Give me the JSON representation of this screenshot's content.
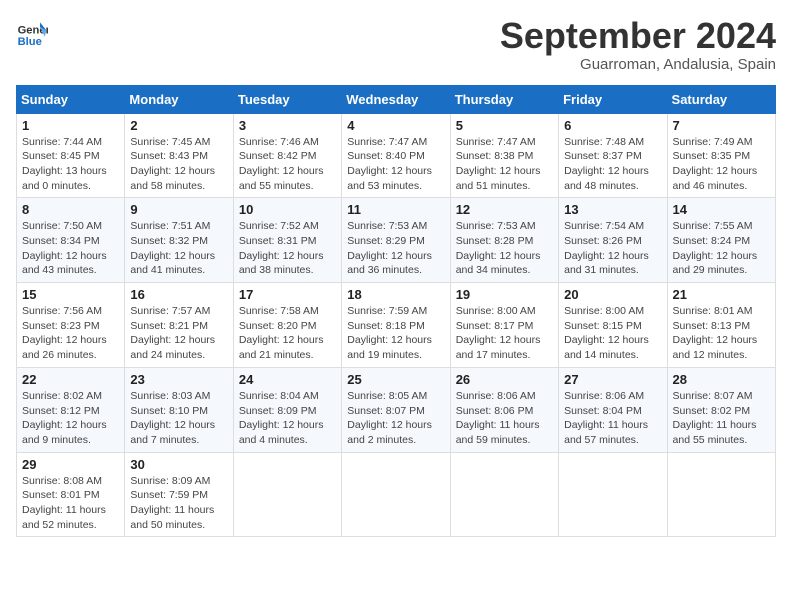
{
  "header": {
    "logo_line1": "General",
    "logo_line2": "Blue",
    "month_title": "September 2024",
    "location": "Guarroman, Andalusia, Spain"
  },
  "columns": [
    "Sunday",
    "Monday",
    "Tuesday",
    "Wednesday",
    "Thursday",
    "Friday",
    "Saturday"
  ],
  "weeks": [
    [
      {
        "day": "1",
        "info": "Sunrise: 7:44 AM\nSunset: 8:45 PM\nDaylight: 13 hours\nand 0 minutes."
      },
      {
        "day": "2",
        "info": "Sunrise: 7:45 AM\nSunset: 8:43 PM\nDaylight: 12 hours\nand 58 minutes."
      },
      {
        "day": "3",
        "info": "Sunrise: 7:46 AM\nSunset: 8:42 PM\nDaylight: 12 hours\nand 55 minutes."
      },
      {
        "day": "4",
        "info": "Sunrise: 7:47 AM\nSunset: 8:40 PM\nDaylight: 12 hours\nand 53 minutes."
      },
      {
        "day": "5",
        "info": "Sunrise: 7:47 AM\nSunset: 8:38 PM\nDaylight: 12 hours\nand 51 minutes."
      },
      {
        "day": "6",
        "info": "Sunrise: 7:48 AM\nSunset: 8:37 PM\nDaylight: 12 hours\nand 48 minutes."
      },
      {
        "day": "7",
        "info": "Sunrise: 7:49 AM\nSunset: 8:35 PM\nDaylight: 12 hours\nand 46 minutes."
      }
    ],
    [
      {
        "day": "8",
        "info": "Sunrise: 7:50 AM\nSunset: 8:34 PM\nDaylight: 12 hours\nand 43 minutes."
      },
      {
        "day": "9",
        "info": "Sunrise: 7:51 AM\nSunset: 8:32 PM\nDaylight: 12 hours\nand 41 minutes."
      },
      {
        "day": "10",
        "info": "Sunrise: 7:52 AM\nSunset: 8:31 PM\nDaylight: 12 hours\nand 38 minutes."
      },
      {
        "day": "11",
        "info": "Sunrise: 7:53 AM\nSunset: 8:29 PM\nDaylight: 12 hours\nand 36 minutes."
      },
      {
        "day": "12",
        "info": "Sunrise: 7:53 AM\nSunset: 8:28 PM\nDaylight: 12 hours\nand 34 minutes."
      },
      {
        "day": "13",
        "info": "Sunrise: 7:54 AM\nSunset: 8:26 PM\nDaylight: 12 hours\nand 31 minutes."
      },
      {
        "day": "14",
        "info": "Sunrise: 7:55 AM\nSunset: 8:24 PM\nDaylight: 12 hours\nand 29 minutes."
      }
    ],
    [
      {
        "day": "15",
        "info": "Sunrise: 7:56 AM\nSunset: 8:23 PM\nDaylight: 12 hours\nand 26 minutes."
      },
      {
        "day": "16",
        "info": "Sunrise: 7:57 AM\nSunset: 8:21 PM\nDaylight: 12 hours\nand 24 minutes."
      },
      {
        "day": "17",
        "info": "Sunrise: 7:58 AM\nSunset: 8:20 PM\nDaylight: 12 hours\nand 21 minutes."
      },
      {
        "day": "18",
        "info": "Sunrise: 7:59 AM\nSunset: 8:18 PM\nDaylight: 12 hours\nand 19 minutes."
      },
      {
        "day": "19",
        "info": "Sunrise: 8:00 AM\nSunset: 8:17 PM\nDaylight: 12 hours\nand 17 minutes."
      },
      {
        "day": "20",
        "info": "Sunrise: 8:00 AM\nSunset: 8:15 PM\nDaylight: 12 hours\nand 14 minutes."
      },
      {
        "day": "21",
        "info": "Sunrise: 8:01 AM\nSunset: 8:13 PM\nDaylight: 12 hours\nand 12 minutes."
      }
    ],
    [
      {
        "day": "22",
        "info": "Sunrise: 8:02 AM\nSunset: 8:12 PM\nDaylight: 12 hours\nand 9 minutes."
      },
      {
        "day": "23",
        "info": "Sunrise: 8:03 AM\nSunset: 8:10 PM\nDaylight: 12 hours\nand 7 minutes."
      },
      {
        "day": "24",
        "info": "Sunrise: 8:04 AM\nSunset: 8:09 PM\nDaylight: 12 hours\nand 4 minutes."
      },
      {
        "day": "25",
        "info": "Sunrise: 8:05 AM\nSunset: 8:07 PM\nDaylight: 12 hours\nand 2 minutes."
      },
      {
        "day": "26",
        "info": "Sunrise: 8:06 AM\nSunset: 8:06 PM\nDaylight: 11 hours\nand 59 minutes."
      },
      {
        "day": "27",
        "info": "Sunrise: 8:06 AM\nSunset: 8:04 PM\nDaylight: 11 hours\nand 57 minutes."
      },
      {
        "day": "28",
        "info": "Sunrise: 8:07 AM\nSunset: 8:02 PM\nDaylight: 11 hours\nand 55 minutes."
      }
    ],
    [
      {
        "day": "29",
        "info": "Sunrise: 8:08 AM\nSunset: 8:01 PM\nDaylight: 11 hours\nand 52 minutes."
      },
      {
        "day": "30",
        "info": "Sunrise: 8:09 AM\nSunset: 7:59 PM\nDaylight: 11 hours\nand 50 minutes."
      },
      {
        "day": "",
        "info": ""
      },
      {
        "day": "",
        "info": ""
      },
      {
        "day": "",
        "info": ""
      },
      {
        "day": "",
        "info": ""
      },
      {
        "day": "",
        "info": ""
      }
    ]
  ]
}
